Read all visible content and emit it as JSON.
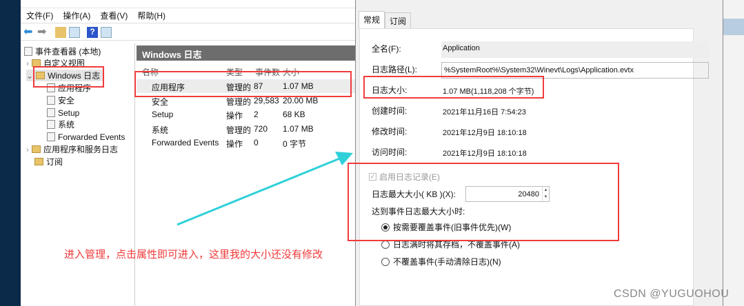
{
  "menu": [
    "文件(F)",
    "操作(A)",
    "查看(V)",
    "帮助(H)"
  ],
  "tree": {
    "root": "事件查看器 (本地)",
    "custom": "自定义视图",
    "windows_logs": "Windows 日志",
    "children": [
      "应用程序",
      "安全",
      "Setup",
      "系统",
      "Forwarded Events"
    ],
    "app_service": "应用程序和服务日志",
    "subscriptions": "订阅"
  },
  "list": {
    "title": "Windows 日志",
    "headers": [
      "名称",
      "类型",
      "事件数",
      "大小"
    ],
    "rows": [
      [
        "应用程序",
        "管理的",
        "87",
        "1.07 MB"
      ],
      [
        "安全",
        "管理的",
        "29,583",
        "20.00 MB"
      ],
      [
        "Setup",
        "操作",
        "2",
        "68 KB"
      ],
      [
        "系统",
        "管理的",
        "720",
        "1.07 MB"
      ],
      [
        "Forwarded Events",
        "操作",
        "0",
        "0 字节"
      ]
    ]
  },
  "dialog": {
    "tabs": [
      "常规",
      "订阅"
    ],
    "full_name_label": "全名(F):",
    "full_name": "Application",
    "path_label": "日志路径(L):",
    "path": "%SystemRoot%\\System32\\Winevt\\Logs\\Application.evtx",
    "size_label": "日志大小:",
    "size": "1.07 MB(1,118,208 个字节)",
    "created_label": "创建时间:",
    "created": "2021年11月16日 7:54:23",
    "modified_label": "修改时间:",
    "modified": "2021年12月9日 18:10:18",
    "accessed_label": "访问时间:",
    "accessed": "2021年12月9日 18:10:18",
    "enable_label": "启用日志记录(E)",
    "max_label": "日志最大大小( KB )(X):",
    "max_value": "20480",
    "when_label": "达到事件日志最大大小时:",
    "options": [
      "按需要覆盖事件(旧事件优先)(W)",
      "日志满时将其存档，不覆盖事件(A)",
      "不覆盖事件(手动清除日志)(N)"
    ]
  },
  "annotation": "进入管理，点击属性即可进入，这里我的大小还没有修改",
  "watermark": "CSDN @YUGUOHOU",
  "colors": {
    "annotation": "#f03a3a",
    "arrow": "#2fd0d8"
  }
}
